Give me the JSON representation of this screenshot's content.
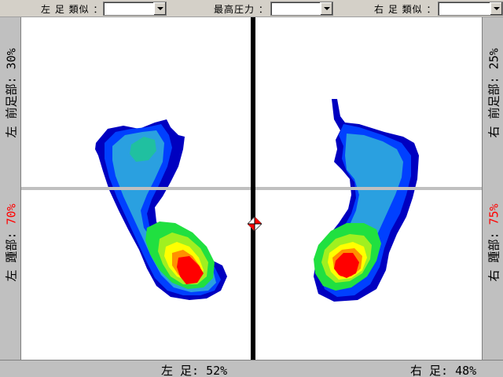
{
  "toolbar": {
    "left_similarity_label": "左 足 類似 ：",
    "left_similarity_value": "",
    "max_pressure_label": "最高圧力 ：",
    "max_pressure_value": "",
    "right_similarity_label": "右 足 類似 ：",
    "right_similarity_value": ""
  },
  "left_side": {
    "forefoot_label": "左 前足部: ",
    "forefoot_pct": "30%",
    "heel_label": "左 踵部: ",
    "heel_pct": "70%"
  },
  "right_side": {
    "forefoot_label": "右 前足部: ",
    "forefoot_pct": "25%",
    "heel_label": "右 踵部: ",
    "heel_pct": "75%"
  },
  "bottom": {
    "left_foot": "左 足: 52%",
    "right_foot": "右 足: 48%"
  },
  "heatmap_colors": {
    "navy": "#0000c0",
    "blue": "#0040ff",
    "light_blue": "#2aa0e0",
    "teal": "#20c0a0",
    "green": "#20e040",
    "yellow_green": "#a0f020",
    "yellow": "#ffff00",
    "orange": "#ff9000",
    "red": "#ff0000"
  },
  "icons": {
    "center_marker": "target-diamond-icon"
  }
}
